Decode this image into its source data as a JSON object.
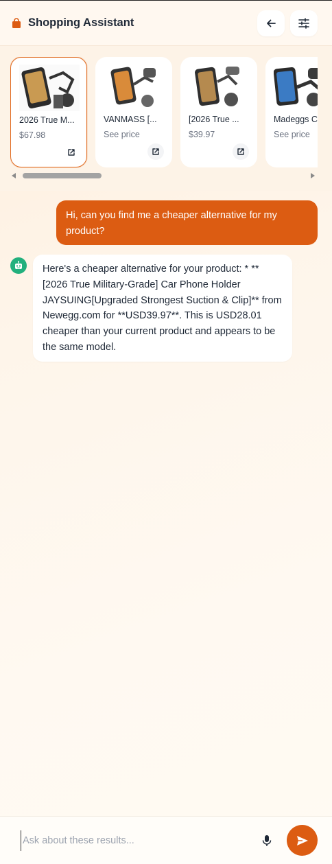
{
  "header": {
    "title": "Shopping Assistant",
    "brand_icon": "shopping-bag-icon",
    "back_icon": "arrow-left-icon",
    "filter_icon": "sliders-icon"
  },
  "products": [
    {
      "title": "2026 True M...",
      "price": "$67.98",
      "selected": true
    },
    {
      "title": "VANMASS [...",
      "price": "See price",
      "selected": false
    },
    {
      "title": "[2026 True ...",
      "price": "$39.97",
      "selected": false
    },
    {
      "title": "Madeggs C...",
      "price": "See price",
      "selected": false
    }
  ],
  "chat": {
    "user_message": "Hi, can you find me a cheaper alternative for my product?",
    "bot_message": "Here's a cheaper alternative for your product: * ** [2026 True Military-Grade] Car Phone Holder JAYSUING[Upgraded Strongest Suction & Clip]** from Newegg.com for **USD39.97**. This is USD28.01 cheaper than your current product and appears to be the same model."
  },
  "input": {
    "placeholder": "Ask about these results...",
    "value": ""
  },
  "colors": {
    "accent": "#dc5c12",
    "bot_avatar": "#22b07d",
    "selected_border": "#e06a1f"
  }
}
